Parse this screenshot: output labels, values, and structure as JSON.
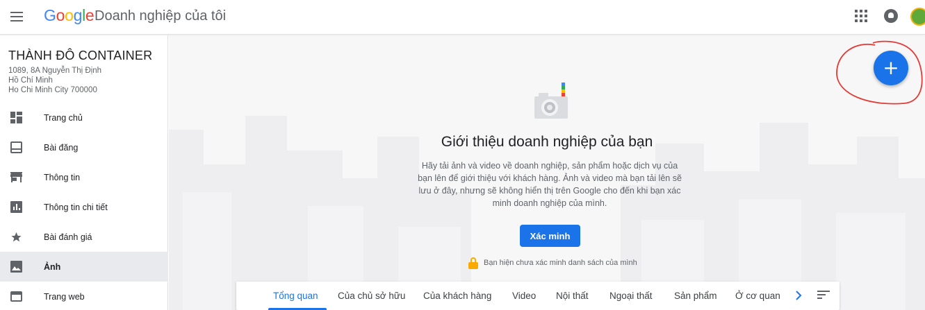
{
  "header": {
    "logo": [
      "G",
      "o",
      "o",
      "g",
      "l",
      "e"
    ],
    "logo_colors": [
      "#4285f4",
      "#ea4335",
      "#fbbc05",
      "#4285f4",
      "#34a853",
      "#ea4335"
    ],
    "product_name": "Doanh nghiệp của tôi"
  },
  "business": {
    "name": "THÀNH ĐÔ CONTAINER",
    "address_lines": [
      "1089, 8A Nguyễn Thị Định",
      "Hồ Chí Minh",
      "Ho Chi Minh City 700000"
    ]
  },
  "sidebar": {
    "items": [
      {
        "label": "Trang chủ",
        "icon": "dashboard-icon"
      },
      {
        "label": "Bài đăng",
        "icon": "posts-icon"
      },
      {
        "label": "Thông tin",
        "icon": "store-icon"
      },
      {
        "label": "Thông tin chi tiết",
        "icon": "insights-icon"
      },
      {
        "label": "Bài đánh giá",
        "icon": "star-icon"
      },
      {
        "label": "Ảnh",
        "icon": "photo-icon",
        "active": true
      },
      {
        "label": "Trang web",
        "icon": "web-icon"
      }
    ]
  },
  "main": {
    "headline": "Giới thiệu doanh nghiệp của bạn",
    "description": "Hãy tải ảnh và video về doanh nghiệp, sản phẩm hoặc dịch vụ của bạn lên để giới thiệu với khách hàng. Ảnh và video mà bạn tải lên sẽ lưu ở đây, nhưng sẽ không hiển thị trên Google cho đến khi bạn xác minh doanh nghiệp của mình.",
    "verify_button": "Xác minh",
    "lock_notice": "Bạn hiện chưa xác minh danh sách của mình",
    "fab_label": "+"
  },
  "tabs": {
    "items": [
      "Tổng quan",
      "Của chủ sở hữu",
      "Của khách hàng",
      "Video",
      "Nội thất",
      "Ngoại thất",
      "Sản phẩm",
      "Ở cơ quan"
    ],
    "active_index": 0
  },
  "colors": {
    "accent": "#1a73e8",
    "annotation": "#e53935",
    "lock": "#f9ab00"
  }
}
